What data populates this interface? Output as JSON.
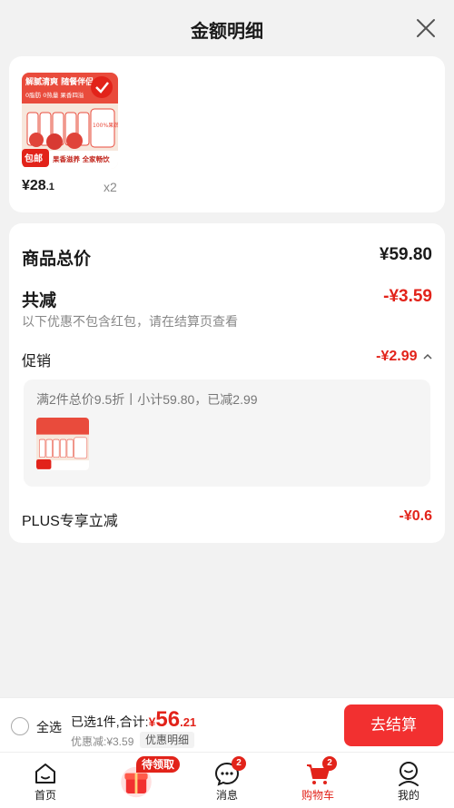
{
  "header": {
    "title": "金额明细"
  },
  "product": {
    "price_main": "¥28",
    "price_decimal": ".1",
    "qty": "x2",
    "image": {
      "top_text": "解腻清爽 随餐伴侣",
      "sub_text": "0脂肪 0热量 果香四溢",
      "shipping_tag": "包邮",
      "bottom_text": "果香滋养 全家畅饮",
      "can_text": "100%果蔬汁"
    }
  },
  "summary": {
    "total_label": "商品总价",
    "total_value": "¥59.80",
    "reduce_label": "共减",
    "reduce_value": "-¥3.59",
    "reduce_note": "以下优惠不包含红包，请在结算页查看",
    "promo_label": "促销",
    "promo_value": "-¥2.99",
    "promo_detail": "满2件总价9.5折丨小计59.80，已减2.99",
    "plus_label": "PLUS专享立减",
    "plus_value": "-¥0.6"
  },
  "bottom_bar": {
    "select_all": "全选",
    "selected_text": "已选1件,合计:",
    "currency": "¥",
    "amount_int": "56",
    "amount_dec": ".21",
    "discount_text": "优惠减:¥3.59",
    "detail_button": "优惠明细",
    "checkout_button": "去结算"
  },
  "tabbar": {
    "tabs": [
      {
        "label": "首页",
        "icon": "home-icon"
      },
      {
        "label": "",
        "icon": "gift-icon",
        "badge_text": "待领取"
      },
      {
        "label": "消息",
        "icon": "message-icon",
        "badge": "2"
      },
      {
        "label": "购物车",
        "icon": "cart-icon",
        "badge": "2"
      },
      {
        "label": "我的",
        "icon": "user-icon"
      }
    ]
  },
  "colors": {
    "accent": "#e2231a",
    "checkout": "#f23030",
    "background": "#f2f2f2"
  }
}
